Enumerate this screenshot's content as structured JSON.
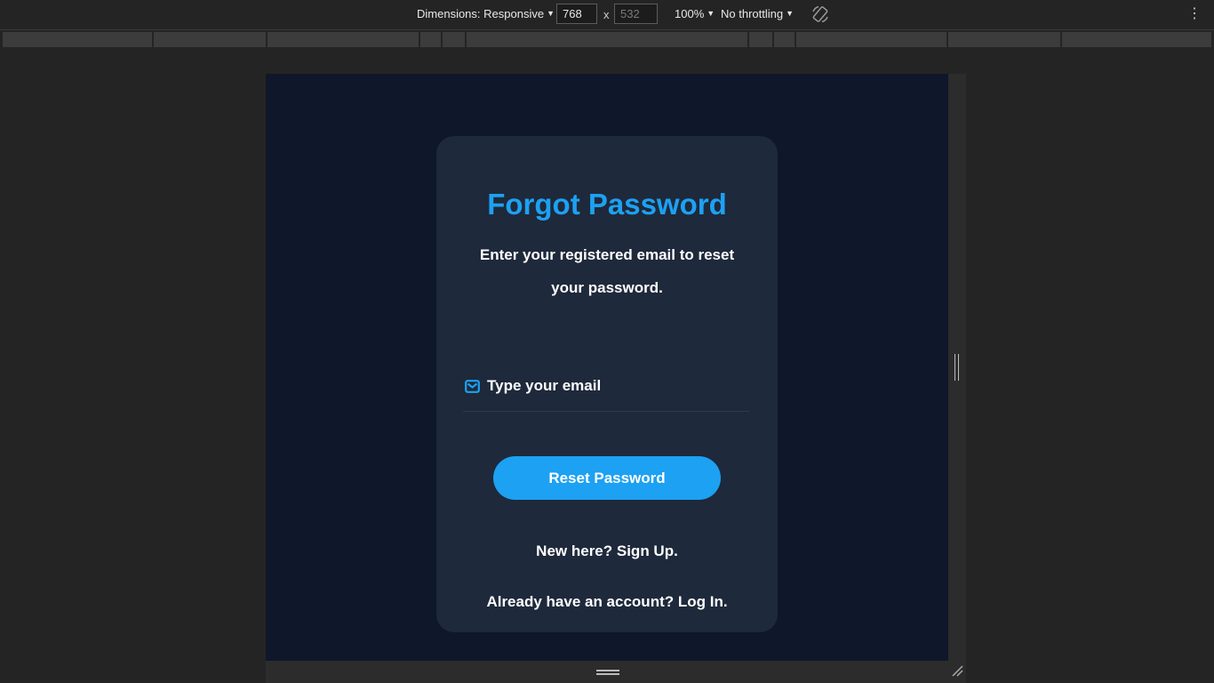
{
  "devtools": {
    "dimensions_label": "Dimensions: Responsive",
    "width_value": "768",
    "height_placeholder": "532",
    "times_symbol": "x",
    "zoom": "100%",
    "throttling": "No throttling",
    "caret": "▼",
    "menu_dots": "⋮"
  },
  "page": {
    "title": "Forgot Password",
    "subtitle": "Enter your registered email to reset your password.",
    "email_placeholder": "Type your email",
    "reset_button": "Reset Password",
    "signup_link": "New here? Sign Up.",
    "login_link": "Already have an account? Log In."
  },
  "colors": {
    "accent": "#1da1f2",
    "page_background": "#0f172a",
    "card_background": "#1e293b",
    "devtools_background": "#242424"
  },
  "icons": {
    "email": "envelope-icon",
    "rotate": "rotate-icon",
    "menu": "kebab-menu-icon"
  }
}
